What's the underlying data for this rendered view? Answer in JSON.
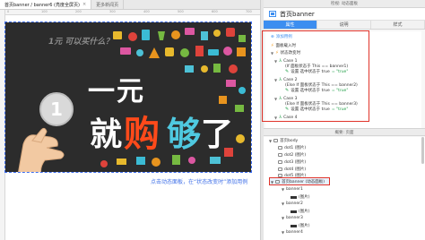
{
  "tabs": [
    {
      "label": "首页banner / banner6 (亮度全屏页)",
      "active": true
    },
    {
      "label": "更多新闻页",
      "active": false
    }
  ],
  "ruler_ticks": [
    "0",
    "100",
    "200",
    "300",
    "400",
    "500",
    "600",
    "700"
  ],
  "banner": {
    "subtitle": "1元 可以买什么？",
    "line1": "一元",
    "coin": "1",
    "w1": "就",
    "w2": "购",
    "w3": "够",
    "w4": "了"
  },
  "canvas_note": "点击动态面板，在“状态改变时”添加用例",
  "right_panel": {
    "header": "检视: 动态面板",
    "name": "首页banner",
    "tabs": [
      "属性",
      "说明",
      "样式"
    ],
    "add_case": "添加用例",
    "events": {
      "load": "面板载入时",
      "state_change": "状态改变时"
    },
    "cases": [
      {
        "name": "Case 1",
        "cond": "(If 面板状态于 This == banner1)",
        "action": "设置 选中状态于 true",
        "action_value": "= \"true\""
      },
      {
        "name": "Case 2",
        "cond": "(Else If 面板状态于 This == banner2)",
        "action": "设置 选中状态于 true",
        "action_value": "= \"true\""
      },
      {
        "name": "Case 3",
        "cond": "(Else If 面板状态于 This == banner3)",
        "action": "设置 选中状态于 true",
        "action_value": "= \"true\""
      },
      {
        "name": "Case 4",
        "cond": "",
        "action": "",
        "action_value": ""
      }
    ],
    "outline_header": "概要: 页面",
    "outline": [
      {
        "label": "首页body",
        "level": 0
      },
      {
        "label": "dot1 (图片)",
        "level": 1
      },
      {
        "label": "dot2 (图片)",
        "level": 1
      },
      {
        "label": "dot3 (图片)",
        "level": 1
      },
      {
        "label": "dot4 (图片)",
        "level": 1
      },
      {
        "label": "dot5 (图片)",
        "level": 1
      },
      {
        "label": "首页banner (动态面板)",
        "level": 0
      },
      {
        "label": "banner1",
        "level": 1
      },
      {
        "label": "(图片)",
        "level": 2
      },
      {
        "label": "banner2",
        "level": 1
      },
      {
        "label": "(图片)",
        "level": 2
      },
      {
        "label": "banner3",
        "level": 1
      },
      {
        "label": "(图片)",
        "level": 2
      },
      {
        "label": "banner4",
        "level": 1
      }
    ]
  }
}
